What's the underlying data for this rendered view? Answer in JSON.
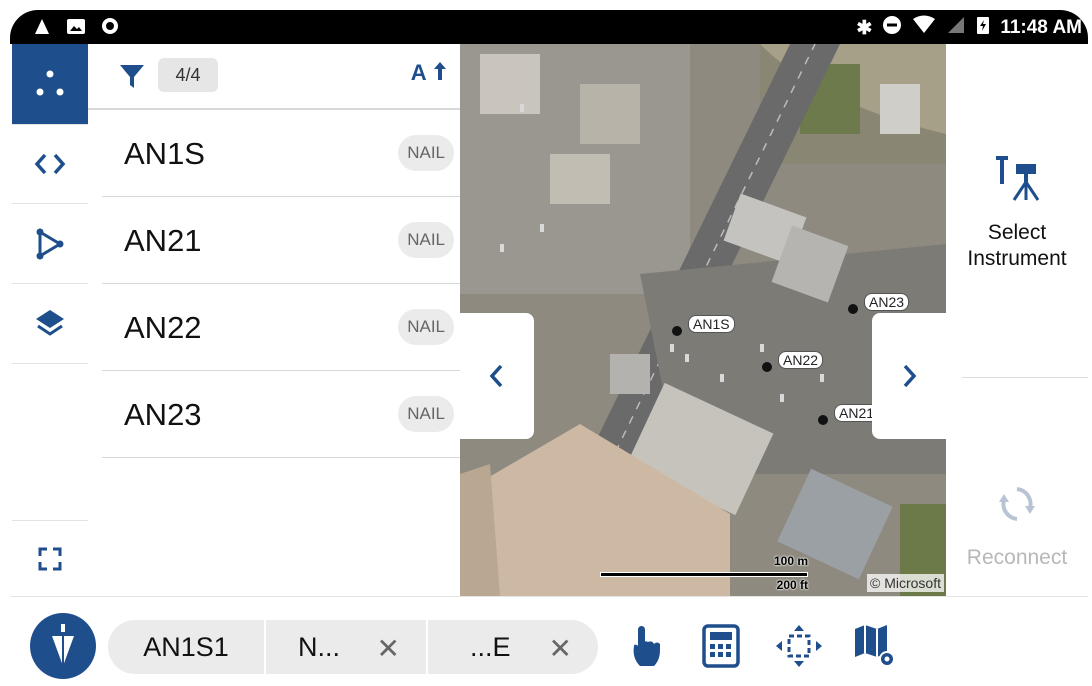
{
  "status_bar": {
    "time": "11:48 AM"
  },
  "rail": {
    "items": [
      {
        "name": "points"
      },
      {
        "name": "code"
      },
      {
        "name": "survey"
      },
      {
        "name": "layers"
      },
      {
        "name": "fullscreen"
      }
    ]
  },
  "list": {
    "count": "4/4",
    "sort_label": "A",
    "rows": [
      {
        "name": "AN1S",
        "tag": "NAIL"
      },
      {
        "name": "AN21",
        "tag": "NAIL"
      },
      {
        "name": "AN22",
        "tag": "NAIL"
      },
      {
        "name": "AN23",
        "tag": "NAIL"
      }
    ]
  },
  "map": {
    "points": [
      "AN1S",
      "AN22",
      "AN23",
      "AN21"
    ],
    "scale_metric": "100 m",
    "scale_imperial": "200 ft",
    "attribution": "© Microsoft"
  },
  "right_panel": {
    "select_instrument": "Select Instrument",
    "reconnect": "Reconnect"
  },
  "bottom": {
    "pills": [
      {
        "label": "AN1S1"
      },
      {
        "label": "N..."
      },
      {
        "label": "...E"
      }
    ],
    "close_symbol": "✕"
  },
  "colors": {
    "accent": "#1f4e8c",
    "disabled": "#b8c4d4"
  }
}
